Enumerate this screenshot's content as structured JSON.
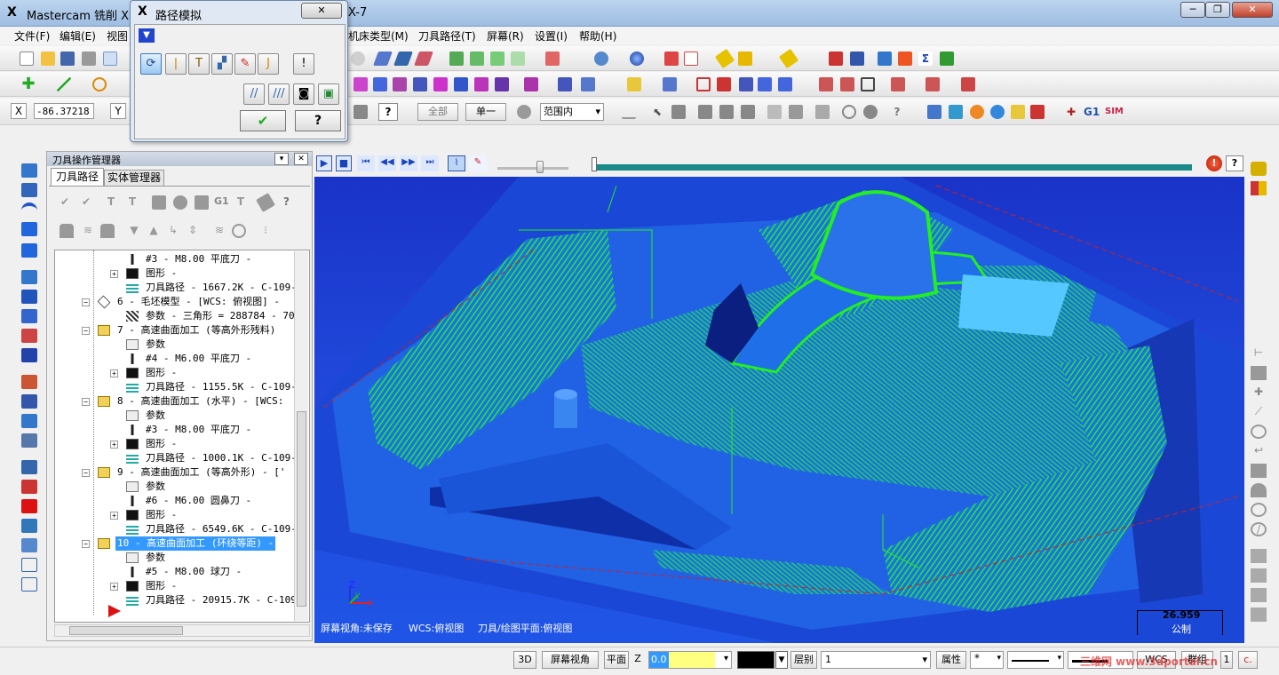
{
  "app": {
    "title": "Mastercam 铣削 X7",
    "title_suffix": "X-7",
    "minimize": "─",
    "restore": "❐",
    "close": "✕"
  },
  "menu": [
    "文件(F)",
    "编辑(E)",
    "视图",
    "机床类型(M)",
    "刀具路径(T)",
    "屏幕(R)",
    "设置(I)",
    "帮助(H)"
  ],
  "dialog": {
    "title": "路径模拟",
    "close": "✕",
    "ok": "✔",
    "help": "?",
    "info": "!"
  },
  "coords": {
    "x_label": "X",
    "x_value": "-86.37218",
    "y_label": "Y"
  },
  "toolbar3": {
    "all": "全部",
    "single": "单一",
    "range_value": "范围内",
    "help": "?"
  },
  "toolbar_right": {
    "g1": "G1",
    "sim": "SIM"
  },
  "panel": {
    "title": "刀具操作管理器",
    "tabs": [
      "刀具路径",
      "实体管理器"
    ],
    "help": "?"
  },
  "tree": [
    {
      "text": "#3 - M8.00 平底刀 -",
      "level": 2,
      "icon": "tool-icon",
      "sel": false
    },
    {
      "text": "图形 -",
      "level": 2,
      "icon": "geometry-icon",
      "sel": false
    },
    {
      "text": "刀具路径 - 1667.2K - C-109-A",
      "level": 2,
      "icon": "toolpath-icon",
      "sel": false
    },
    {
      "text": "6 - 毛坯模型 - [WCS: 俯视图] -",
      "level": 1,
      "icon": "stock-icon",
      "sel": false
    },
    {
      "text": "参数 - 三角形 = 288784 - 70",
      "level": 2,
      "icon": "param-hatch-icon",
      "sel": false
    },
    {
      "text": "7 - 高速曲面加工 (等高外形残料)",
      "level": 1,
      "icon": "folder-icon",
      "sel": false
    },
    {
      "text": "参数",
      "level": 2,
      "icon": "param-icon",
      "sel": false
    },
    {
      "text": "#4 - M6.00 平底刀 -",
      "level": 2,
      "icon": "tool-icon",
      "sel": false
    },
    {
      "text": "图形 -",
      "level": 2,
      "icon": "geometry-icon",
      "sel": false
    },
    {
      "text": "刀具路径 - 1155.5K - C-109-A",
      "level": 2,
      "icon": "toolpath-icon",
      "sel": false
    },
    {
      "text": "8 - 高速曲面加工 (水平) - [WCS:",
      "level": 1,
      "icon": "folder-icon",
      "sel": false
    },
    {
      "text": "参数",
      "level": 2,
      "icon": "param-icon",
      "sel": false
    },
    {
      "text": "#3 - M8.00 平底刀 -",
      "level": 2,
      "icon": "tool-icon",
      "sel": false
    },
    {
      "text": "图形 -",
      "level": 2,
      "icon": "geometry-icon",
      "sel": false
    },
    {
      "text": "刀具路径 - 1000.1K - C-109-A",
      "level": 2,
      "icon": "toolpath-icon",
      "sel": false
    },
    {
      "text": "9 - 高速曲面加工 (等高外形) - ['",
      "level": 1,
      "icon": "folder-icon",
      "sel": false
    },
    {
      "text": "参数",
      "level": 2,
      "icon": "param-icon",
      "sel": false
    },
    {
      "text": "#6 - M6.00 圆鼻刀 -",
      "level": 2,
      "icon": "tool-icon",
      "sel": false
    },
    {
      "text": "图形 -",
      "level": 2,
      "icon": "geometry-icon",
      "sel": false
    },
    {
      "text": "刀具路径 - 6549.6K - C-109-A",
      "level": 2,
      "icon": "toolpath-icon",
      "sel": false
    },
    {
      "text": "10 - 高速曲面加工 (环绕等距) -",
      "level": 1,
      "icon": "folder-icon",
      "sel": true
    },
    {
      "text": "参数",
      "level": 2,
      "icon": "param-icon",
      "sel": false
    },
    {
      "text": "#5 - M8.00 球刀 -",
      "level": 2,
      "icon": "tool-icon",
      "sel": false
    },
    {
      "text": "图形 -",
      "level": 2,
      "icon": "geometry-icon",
      "sel": false
    },
    {
      "text": "刀具路径 - 20915.7K - C-109-",
      "level": 2,
      "icon": "toolpath-icon",
      "sel": false
    }
  ],
  "viewport": {
    "screen_view": "屏幕视角:未保存",
    "wcs": "WCS:俯视图",
    "plane": "刀具/绘图平面:俯视图",
    "scale_value": "26.959",
    "scale_unit": "公制",
    "axis_z": "Z",
    "axis_x": "X",
    "axis_y": "Y"
  },
  "status": {
    "btn_3d": "3D",
    "screen_view": "屏幕视角",
    "plane": "平面",
    "z_label": "Z",
    "z_value": "0.0",
    "layer_label": "层别",
    "layer_value": "1",
    "attributes": "属性",
    "wcs": "WCS",
    "group": "群组",
    "watermark": "三维网 www.3dportal.cn"
  },
  "colors": {
    "toolpath": "#22ee22",
    "part": "#1e6fe8",
    "selection": "#3399ff",
    "stock_bg": "#1a33c8",
    "sim_progress": "#1a8a8a",
    "z_field": "#ffff80"
  }
}
